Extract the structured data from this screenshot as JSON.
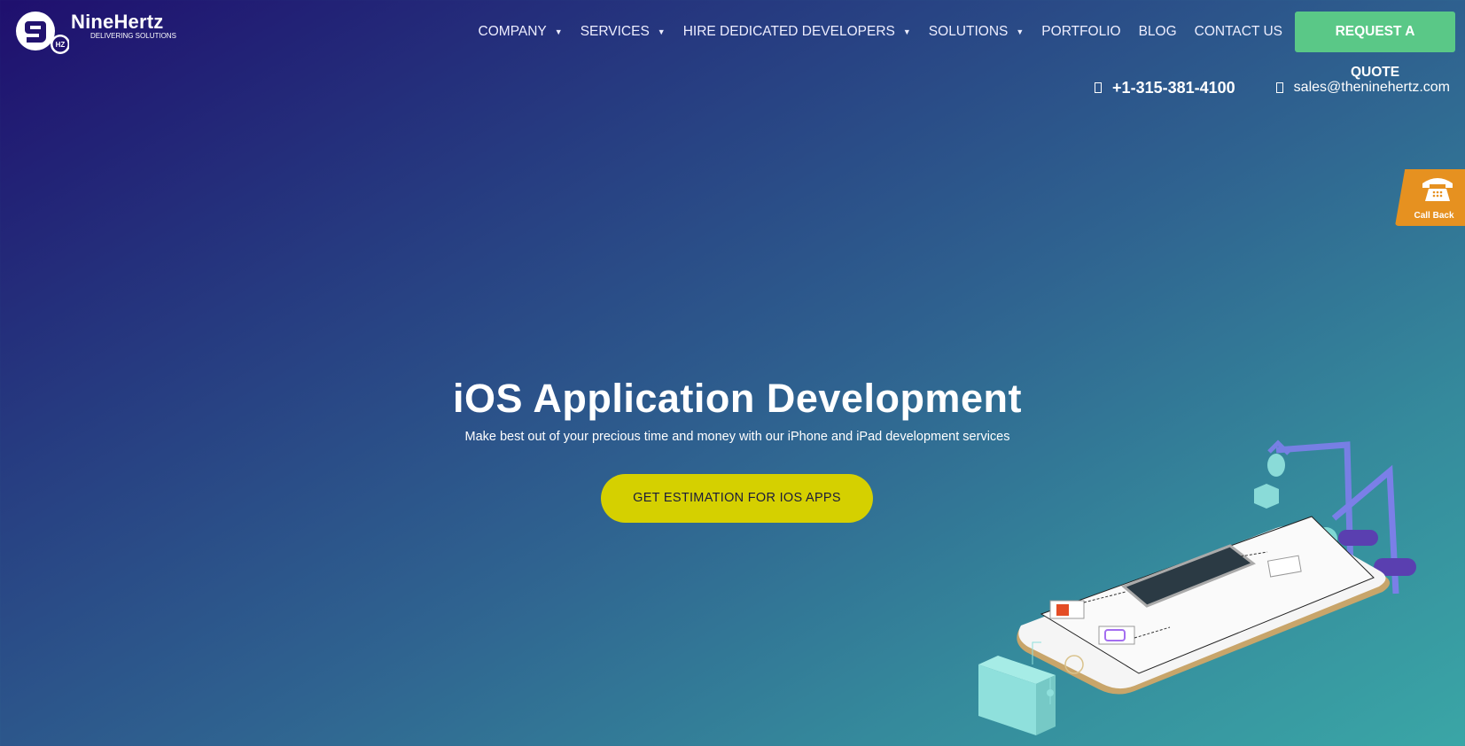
{
  "logo": {
    "brand": "NineHertz",
    "tagline": "DELIVERING SOLUTIONS",
    "badge": "HZ"
  },
  "nav": {
    "items": [
      {
        "label": "COMPANY",
        "dropdown": true
      },
      {
        "label": "SERVICES",
        "dropdown": true
      },
      {
        "label": "HIRE DEDICATED DEVELOPERS",
        "dropdown": true
      },
      {
        "label": "SOLUTIONS",
        "dropdown": true
      },
      {
        "label": "PORTFOLIO",
        "dropdown": false
      },
      {
        "label": "BLOG",
        "dropdown": false
      },
      {
        "label": "CONTACT US",
        "dropdown": false
      }
    ],
    "caret": "▼",
    "cta": "REQUEST A QUOTE"
  },
  "contact": {
    "phone": "+1-315-381-4100",
    "email": "sales@theninehertz.com"
  },
  "callback": {
    "label": "Call Back",
    "icon": "telephone-icon"
  },
  "hero": {
    "title": "iOS Application Development",
    "subtitle": "Make best out of your precious time and money with our iPhone and iPad development services",
    "cta": "GET ESTIMATION FOR IOS APPS"
  },
  "colors": {
    "quote_button": "#5ac887",
    "cta_button": "#d5d000",
    "callback": "#e69120"
  }
}
